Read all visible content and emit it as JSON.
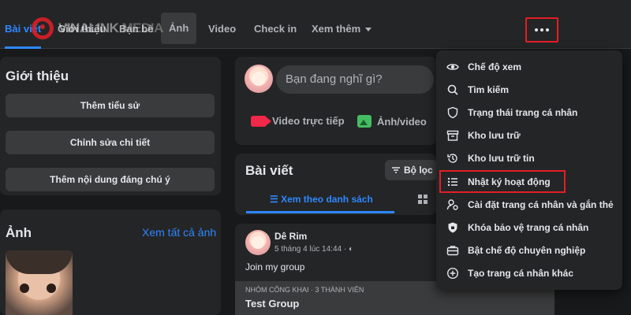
{
  "tabs": [
    {
      "label": "Bài viết",
      "active": true
    },
    {
      "label": "Giới thiệu"
    },
    {
      "label": "Bạn bè"
    },
    {
      "label": "Ảnh",
      "highlighted": true
    },
    {
      "label": "Video"
    },
    {
      "label": "Check in"
    },
    {
      "label": "Xem thêm"
    }
  ],
  "watermark": {
    "brand": "VINALINK",
    "suffix": "MEDIA"
  },
  "intro": {
    "title": "Giới thiệu",
    "buttons": [
      "Thêm tiểu sử",
      "Chỉnh sửa chi tiết",
      "Thêm nội dung đáng chú ý"
    ]
  },
  "photos": {
    "title": "Ảnh",
    "see_all": "Xem tất cả ảnh"
  },
  "composer": {
    "placeholder": "Bạn đang nghĩ gì?",
    "actions": [
      "Video trực tiếp",
      "Ảnh/video"
    ]
  },
  "posts": {
    "title": "Bài viết",
    "filter": "Bộ lọc",
    "list_view": "Xem theo danh sách"
  },
  "post": {
    "author": "Dê Rim",
    "meta": "5 tháng 4 lúc 14:44 · ",
    "text": "Join my group",
    "group_kicker": "NHÓM CÔNG KHAI · 3 THÀNH VIÊN",
    "group_name": "Test Group"
  },
  "menu": [
    {
      "label": "Chế độ xem",
      "icon": "eye-icon"
    },
    {
      "label": "Tìm kiếm",
      "icon": "search-icon"
    },
    {
      "label": "Trạng thái trang cá nhân",
      "icon": "shield-icon"
    },
    {
      "label": "Kho lưu trữ",
      "icon": "archive-icon"
    },
    {
      "label": "Kho lưu trữ tin",
      "icon": "history-icon"
    },
    {
      "label": "Nhật ký hoạt động",
      "icon": "list-icon",
      "highlighted": true
    },
    {
      "label": "Cài đặt trang cá nhân và gắn thẻ",
      "icon": "user-gear-icon"
    },
    {
      "label": "Khóa bảo vệ trang cá nhân",
      "icon": "shield-lock-icon"
    },
    {
      "label": "Bật chế độ chuyên nghiệp",
      "icon": "briefcase-icon"
    },
    {
      "label": "Tạo trang cá nhân khác",
      "icon": "plus-circle-icon"
    }
  ],
  "colors": {
    "accent": "#2d88ff",
    "highlight_border": "#e41e26",
    "background": "#18191a",
    "card": "#242526"
  }
}
